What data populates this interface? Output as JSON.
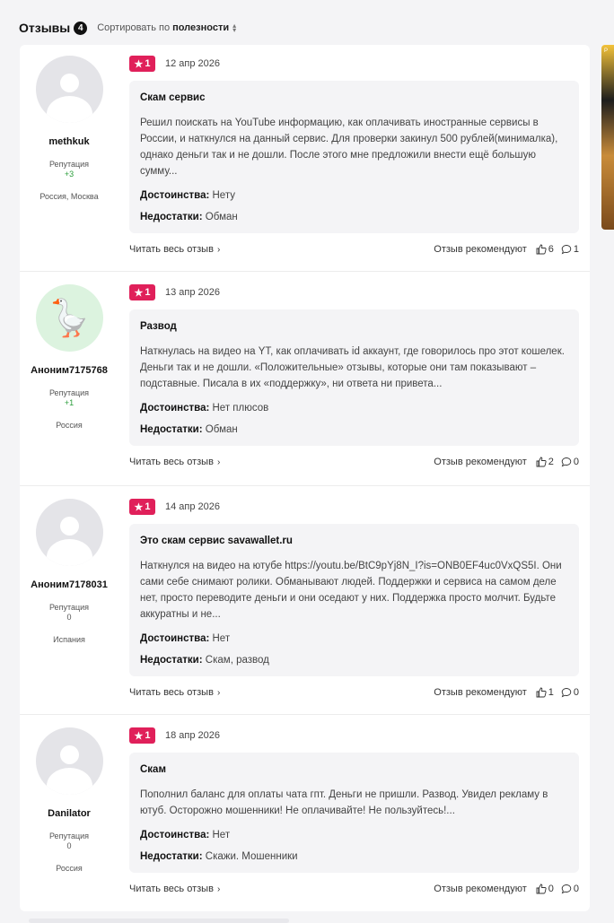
{
  "header": {
    "title": "Отзывы",
    "count": "4",
    "sort_prefix": "Сортировать по",
    "sort_value": "полезности"
  },
  "side_ad": {
    "label": "Р"
  },
  "reviews": [
    {
      "author": {
        "name": "methkuk",
        "reputation_label": "Репутация",
        "reputation": "+3",
        "location": "Россия, Москва",
        "avatar": "default"
      },
      "rating": "1",
      "date": "12 апр 2026",
      "title": "Скам сервис",
      "text": "Решил поискать на YouTube информацию, как оплачивать иностранные сервисы в России, и наткнулся на данный сервис. Для проверки закинул 500 рублей(минималка), однако деньги так и не дошли. После этого мне предложили внести ещё большую сумму...",
      "pros_label": "Достоинства:",
      "pros": "Нету",
      "cons_label": "Недостатки:",
      "cons": "Обман",
      "read_more": "Читать весь отзыв",
      "recommend_label": "Отзыв рекомендуют",
      "likes": "6",
      "comments": "1"
    },
    {
      "author": {
        "name": "Аноним7175768",
        "reputation_label": "Репутация",
        "reputation": "+1",
        "location": "Россия",
        "avatar": "goose"
      },
      "rating": "1",
      "date": "13 апр 2026",
      "title": "Развод",
      "text": "Наткнулась на видео на YT, как оплачивать id аккаунт, где говорилось про этот кошелек. Деньги так и не дошли. «Положительные» отзывы, которые они там показывают – подставные. Писала в их «поддержку», ни ответа ни привета...",
      "pros_label": "Достоинства:",
      "pros": "Нет плюсов",
      "cons_label": "Недостатки:",
      "cons": "Обман",
      "read_more": "Читать весь отзыв",
      "recommend_label": "Отзыв рекомендуют",
      "likes": "2",
      "comments": "0"
    },
    {
      "author": {
        "name": "Аноним7178031",
        "reputation_label": "Репутация",
        "reputation": "0",
        "location": "Испания",
        "avatar": "default"
      },
      "rating": "1",
      "date": "14 апр 2026",
      "title": "Это скам сервис savawallet.ru",
      "text": "Наткнулся на видео на ютубе https://youtu.be/BtC9pYj8N_I?is=ONB0EF4uc0VxQS5I. Они сами себе снимают ролики. Обманывают людей. Поддержки и сервиса на самом деле нет, просто переводите деньги и они оседают у них. Поддержка просто молчит. Будьте аккуратны и не...",
      "pros_label": "Достоинства:",
      "pros": "Нет",
      "cons_label": "Недостатки:",
      "cons": "Скам, развод",
      "read_more": "Читать весь отзыв",
      "recommend_label": "Отзыв рекомендуют",
      "likes": "1",
      "comments": "0"
    },
    {
      "author": {
        "name": "Danilator",
        "reputation_label": "Репутация",
        "reputation": "0",
        "location": "Россия",
        "avatar": "default"
      },
      "rating": "1",
      "date": "18 апр 2026",
      "title": "Скам",
      "text": "Пополнил баланс для оплаты чата гпт. Деньги не пришли. Развод. Увидел рекламу в ютуб. Осторожно мошенники! Не оплачивайте! Не пользуйтесь!...",
      "pros_label": "Достоинства:",
      "pros": "Нет",
      "cons_label": "Недостатки:",
      "cons": "Скажи. Мошенники",
      "read_more": "Читать весь отзыв",
      "recommend_label": "Отзыв рекомендуют",
      "likes": "0",
      "comments": "0"
    }
  ]
}
